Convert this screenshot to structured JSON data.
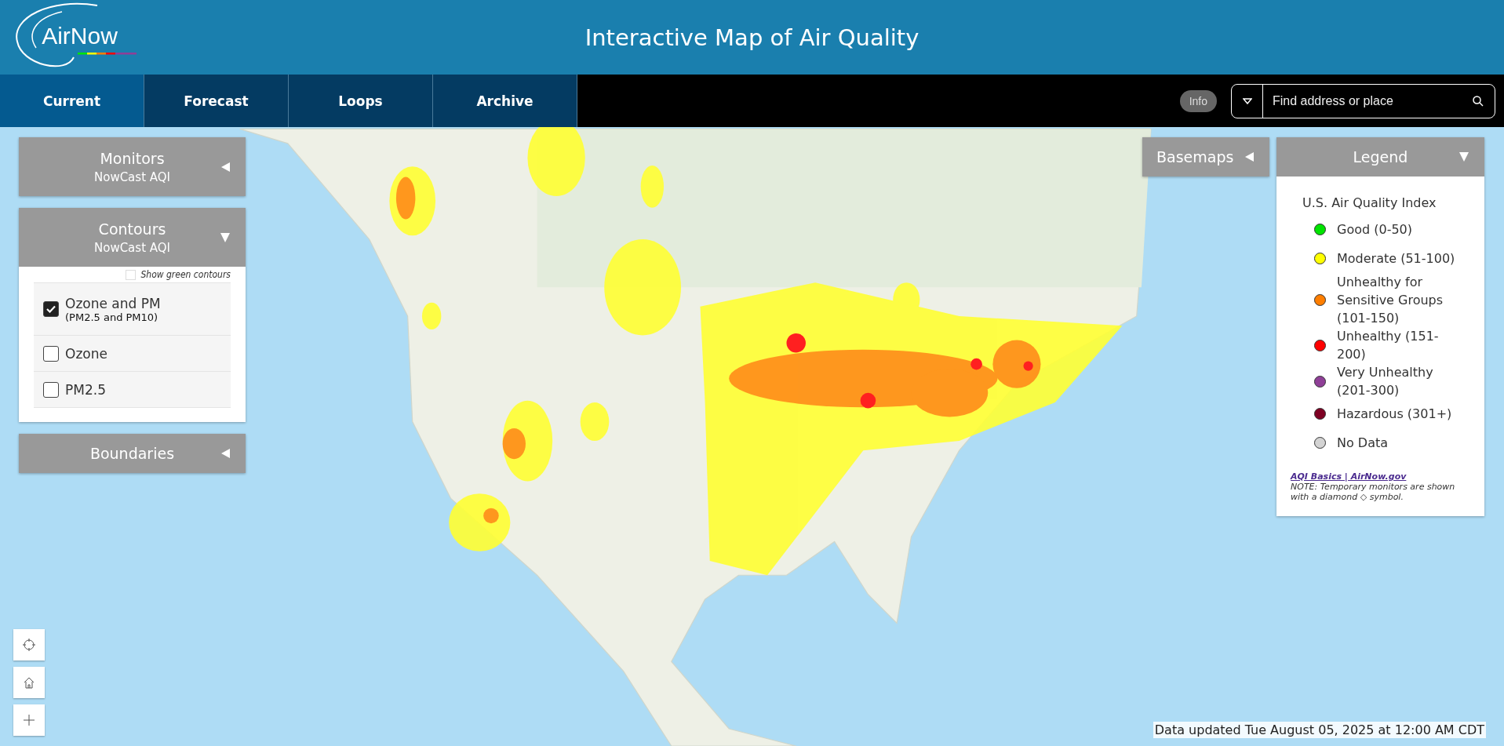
{
  "header": {
    "logo": "AirNow",
    "title": "Interactive Map of Air Quality"
  },
  "tabs": [
    {
      "label": "Current",
      "selected": true
    },
    {
      "label": "Forecast",
      "selected": false
    },
    {
      "label": "Loops",
      "selected": false
    },
    {
      "label": "Archive",
      "selected": false
    }
  ],
  "info_button": "Info",
  "search": {
    "placeholder": "Find address or place"
  },
  "left_panels": [
    {
      "title": "Monitors",
      "subtitle": "NowCast AQI",
      "expanded": false
    },
    {
      "title": "Contours",
      "subtitle": "NowCast AQI",
      "expanded": true,
      "show_green": {
        "label": "Show green contours",
        "checked": false
      },
      "options": [
        {
          "label": "Ozone and PM",
          "note": "(PM2.5 and PM10)",
          "checked": true
        },
        {
          "label": "Ozone",
          "checked": false
        },
        {
          "label": "PM2.5",
          "checked": false
        }
      ]
    },
    {
      "title": "Boundaries",
      "expanded": false
    }
  ],
  "basemaps": {
    "title": "Basemaps",
    "expanded": false
  },
  "legend": {
    "title": "Legend",
    "expanded": true,
    "heading": "U.S. Air Quality Index",
    "items": [
      {
        "label": "Good (0-50)",
        "color": "#00e400"
      },
      {
        "label": "Moderate (51-100)",
        "color": "#ffff00"
      },
      {
        "label": "Unhealthy for Sensitive Groups (101-150)",
        "color": "#ff7e00"
      },
      {
        "label": "Unhealthy (151-200)",
        "color": "#ff0000"
      },
      {
        "label": "Very Unhealthy (201-300)",
        "color": "#8f3f97"
      },
      {
        "label": "Hazardous (301+)",
        "color": "#7e0023"
      },
      {
        "label": "No Data",
        "color": "#d3d3d3"
      }
    ],
    "link": "AQI Basics | AirNow.gov",
    "note": "NOTE: Temporary monitors are shown with a diamond ◇ symbol."
  },
  "updated": "Data updated Tue August 05, 2025 at 12:00 AM CDT"
}
